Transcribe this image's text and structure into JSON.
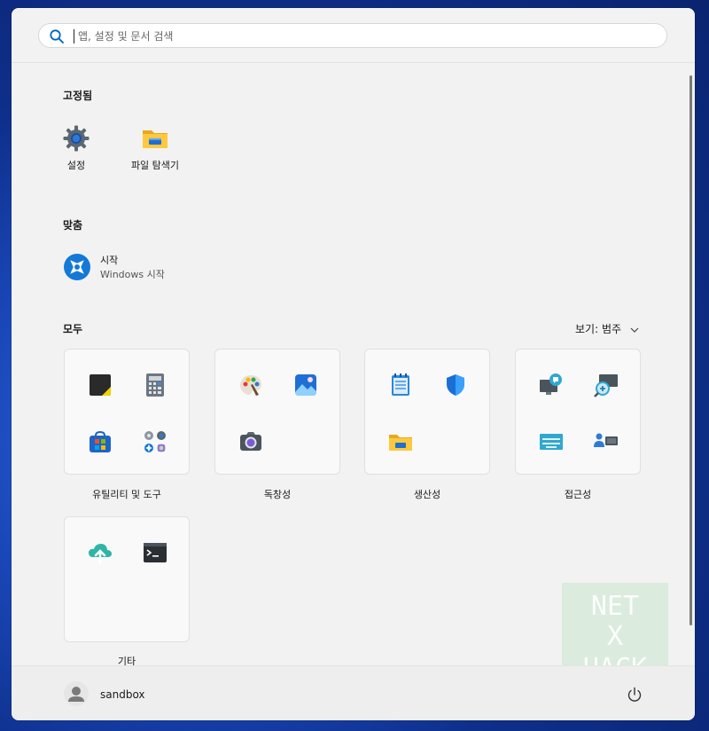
{
  "search": {
    "placeholder": "앱, 설정 및 문서 검색"
  },
  "pinned": {
    "title": "고정됨",
    "items": [
      {
        "label": "설정",
        "icon": "gear-icon"
      },
      {
        "label": "파일 탐색기",
        "icon": "folder-icon"
      }
    ]
  },
  "recommended": {
    "title": "맞춤",
    "items": [
      {
        "title": "시작",
        "subtitle": "Windows 시작",
        "icon": "get-started-icon"
      }
    ]
  },
  "all": {
    "title": "모두",
    "view_label": "보기: 범주",
    "categories": [
      {
        "label": "유틸리티 및 도구",
        "icons": [
          "sticky-notes-icon",
          "calculator-icon",
          "store-icon",
          "control-panel-icon"
        ]
      },
      {
        "label": "독창성",
        "icons": [
          "paint-icon",
          "photos-icon",
          "camera-icon"
        ]
      },
      {
        "label": "생산성",
        "icons": [
          "notepad-icon",
          "defender-icon",
          "folder-icon"
        ]
      },
      {
        "label": "접근성",
        "icons": [
          "narrator-icon",
          "magnifier-icon",
          "onscreen-keyboard-icon",
          "voice-access-icon"
        ]
      },
      {
        "label": "기타",
        "icons": [
          "onedrive-icon",
          "terminal-icon"
        ]
      }
    ]
  },
  "user": {
    "name": "sandbox"
  },
  "watermark": {
    "line1": "NET",
    "line2": "X",
    "line3": "HACK"
  },
  "colors": {
    "accent": "#0067c0",
    "panel": "#f2f2f2",
    "desktop": "#1a47b8"
  }
}
